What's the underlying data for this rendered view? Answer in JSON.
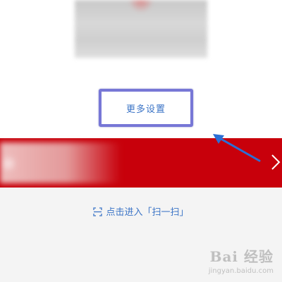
{
  "settings": {
    "more_settings_label": "更多设置"
  },
  "scan": {
    "label": "点击进入「扫一扫」",
    "icon": "scan-icon"
  },
  "banner": {
    "background_color": "#c8000b",
    "chevron_icon": "chevron-right-icon"
  },
  "watermark": {
    "logo_text": "Bai 经验",
    "url": "jingyan.baidu.com"
  },
  "colors": {
    "link": "#3b74c6",
    "highlight": "#7777d6",
    "arrow": "#2b6fd6"
  }
}
